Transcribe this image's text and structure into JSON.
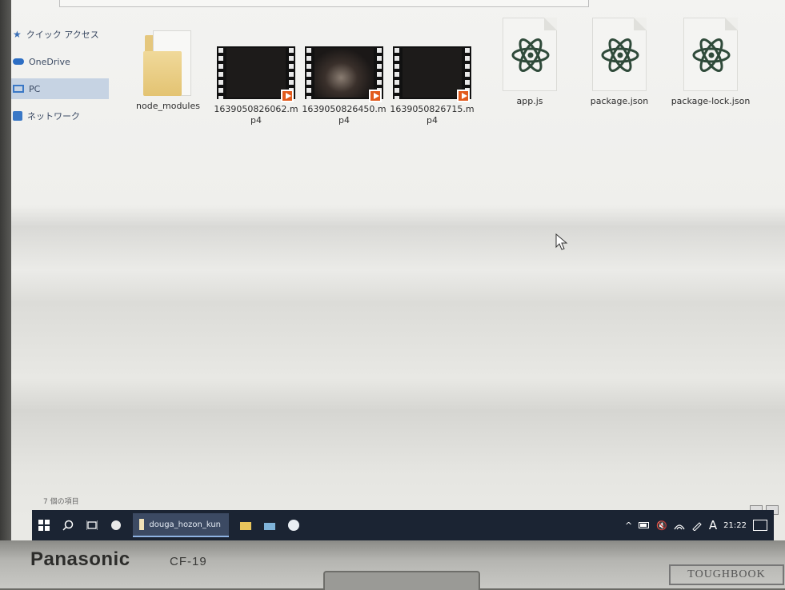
{
  "hardware": {
    "brand": "Panasonic",
    "model": "CF-19",
    "badge": "TOUGHBOOK"
  },
  "nav_pane": {
    "items": [
      {
        "label": "クイック アクセス",
        "icon": "star-icon"
      },
      {
        "label": "OneDrive",
        "icon": "cloud-icon"
      },
      {
        "label": "PC",
        "icon": "computer-icon",
        "selected": true
      },
      {
        "label": "ネットワーク",
        "icon": "network-icon"
      }
    ]
  },
  "files": [
    {
      "name": "node_modules",
      "type": "folder"
    },
    {
      "name": "1639050826062.mp4",
      "type": "video"
    },
    {
      "name": "1639050826450.mp4",
      "type": "video"
    },
    {
      "name": "1639050826715.mp4",
      "type": "video"
    },
    {
      "name": "app.js",
      "type": "atom-file"
    },
    {
      "name": "package.json",
      "type": "atom-file"
    },
    {
      "name": "package-lock.json",
      "type": "atom-file"
    }
  ],
  "status_bar": {
    "item_count": "7 個の項目"
  },
  "taskbar": {
    "app_label": "douga_hozon_kun",
    "ime": "A",
    "clock": "21:22"
  },
  "colors": {
    "taskbar": "#1b2433",
    "selection": "#c6d3e3",
    "video_play_badge": "#e25a1c"
  }
}
